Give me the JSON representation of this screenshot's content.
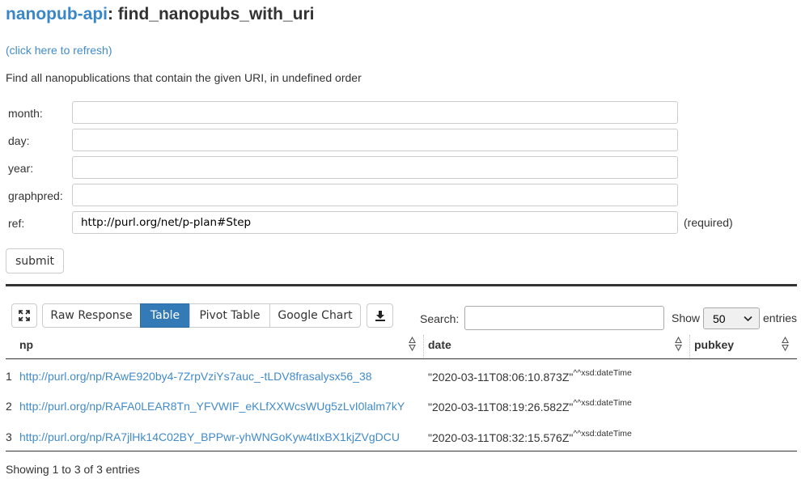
{
  "header": {
    "brand": "nanopub-api",
    "title_suffix": ": find_nanopubs_with_uri",
    "refresh_link": "(click here to refresh)",
    "description": "Find all nanopublications that contain the given URI, in undefined order"
  },
  "form": {
    "fields": [
      {
        "label": "month:",
        "value": ""
      },
      {
        "label": "day:",
        "value": ""
      },
      {
        "label": "year:",
        "value": ""
      },
      {
        "label": "graphpred:",
        "value": ""
      },
      {
        "label": "ref:",
        "value": "http://purl.org/net/p-plan#Step"
      }
    ],
    "required_note": "(required)",
    "submit_label": "submit"
  },
  "toolbar": {
    "view_tabs": [
      {
        "label": "Raw Response",
        "active": false
      },
      {
        "label": "Table",
        "active": true
      },
      {
        "label": "Pivot Table",
        "active": false
      },
      {
        "label": "Google Chart",
        "active": false
      }
    ],
    "fullscreen_icon": "expand-arrows-icon",
    "download_icon": "download-icon",
    "search_label": "Search:",
    "search_value": "",
    "show_label": "Show",
    "page_size": "50",
    "entries_label": "entries"
  },
  "table": {
    "columns": [
      "np",
      "date",
      "pubkey"
    ],
    "rows": [
      {
        "index": "1",
        "np": "http://purl.org/np/RAwE920by4-7ZrpVziYs7auc_-tLDV8frasalysx56_38",
        "date": "\"2020-03-11T08:06:10.873Z\"",
        "datatype": "^^xsd:dateTime",
        "pubkey": ""
      },
      {
        "index": "2",
        "np": "http://purl.org/np/RAFA0LEAR8Tn_YFVWIF_eKLfXXWcsWUg5zLvI0lalm7kY",
        "date": "\"2020-03-11T08:19:26.582Z\"",
        "datatype": "^^xsd:dateTime",
        "pubkey": ""
      },
      {
        "index": "3",
        "np": "http://purl.org/np/RA7jlHk14C02BY_BPPwr-yhWNGoKyw4tIxBX1kjZVgDCU",
        "date": "\"2020-03-11T08:32:15.576Z\"",
        "datatype": "^^xsd:dateTime",
        "pubkey": ""
      }
    ],
    "info": "Showing 1 to 3 of 3 entries"
  },
  "colors": {
    "brand": "#3a87c8",
    "link": "#428bca",
    "active_tab": "#337ab7"
  }
}
